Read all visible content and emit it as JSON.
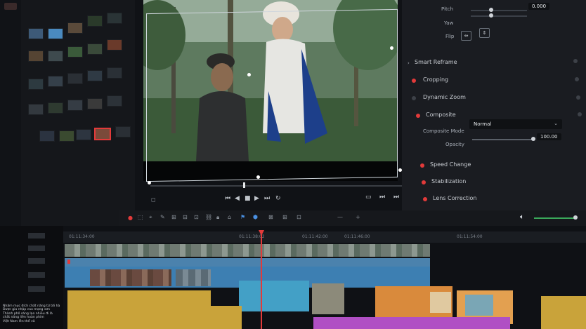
{
  "inspector": {
    "pitch_label": "Pitch",
    "pitch_value": "0.000",
    "yaw_label": "Yaw",
    "flip_label": "Flip",
    "smart_reframe": "Smart Reframe",
    "cropping": "Cropping",
    "dynamic_zoom": "Dynamic Zoom",
    "composite": "Composite",
    "composite_mode_label": "Composite Mode",
    "composite_mode_value": "Normal",
    "opacity_label": "Opacity",
    "opacity_value": "100.00",
    "speed_change": "Speed Change",
    "stabilization": "Stabilization",
    "lens_correction": "Lens Correction"
  },
  "timeline": {
    "timecodes": [
      "01:11:34:00",
      "01:11:38:02",
      "01:11:42:00",
      "01:11:46:00",
      "01:11:54:00"
    ]
  },
  "subtitle": {
    "lines": [
      "Nhãm mục đích chất năng từ tới hà",
      "Được gia nhập cao mạng sơn",
      "Thành phố sáng lạo nhiều đi là",
      "chất năng liên hoàn phim",
      "Việt Nam lên thể vũ"
    ]
  },
  "colors": {
    "accent_red": "#e23a3a",
    "clip_blue": "#3d7fb2",
    "clip_orange": "#d98a3c",
    "clip_yellow": "#c9a33a",
    "clip_purple": "#b04fc4",
    "playhead": "#e23a3a"
  }
}
